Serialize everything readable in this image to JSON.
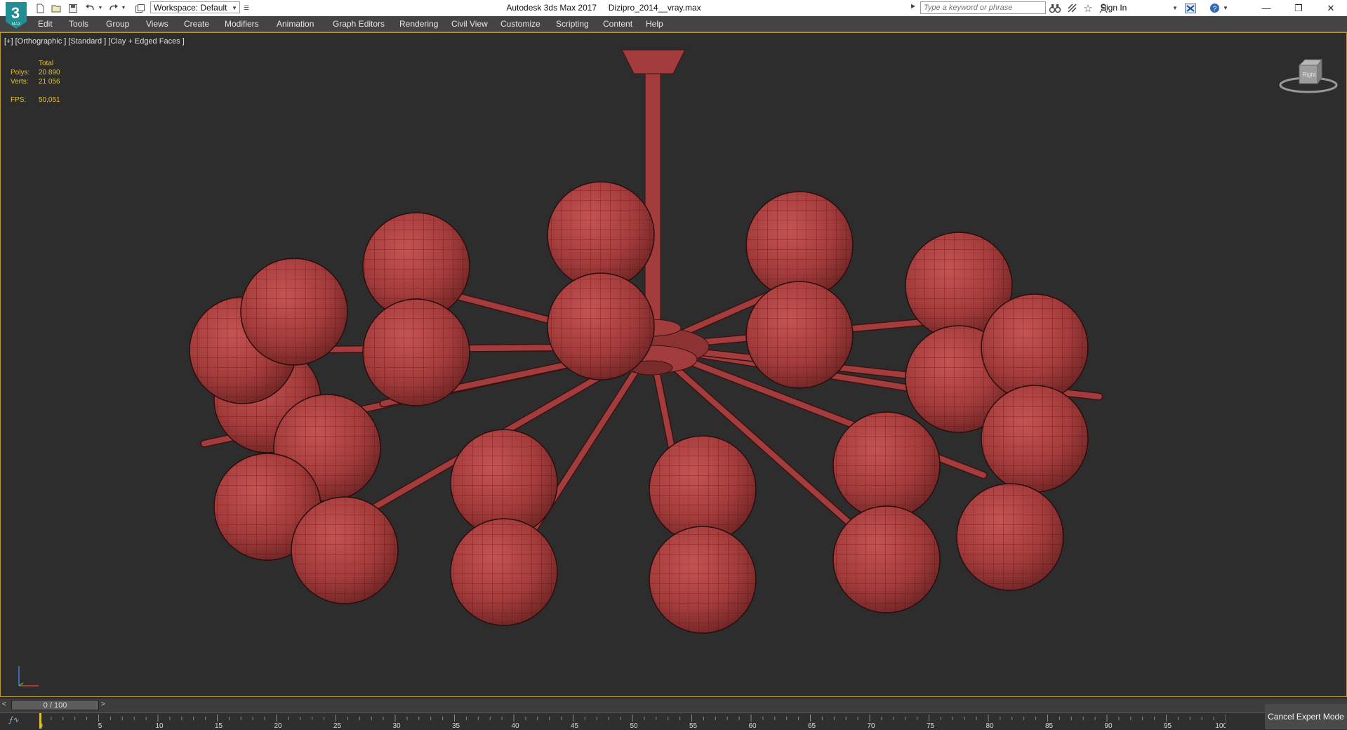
{
  "app": {
    "logo_text": "3",
    "logo_subtext": "MAX",
    "window_title": "Autodesk 3ds Max 2017     Dizipro_2014__vray.max"
  },
  "quick_access": {
    "workspace_value": "Workspace: Default",
    "icons": [
      "new-file-icon",
      "open-file-icon",
      "save-icon",
      "undo-icon",
      "redo-icon",
      "project-folder-icon"
    ]
  },
  "infocenter": {
    "search_placeholder": "Type a keyword or phrase",
    "sign_in": "Sign In",
    "icons": [
      "binoculars-icon",
      "subscription-icon",
      "favorites-star-icon",
      "user-icon",
      "exchange-icon",
      "help-icon"
    ]
  },
  "window_controls": [
    "minimize-icon",
    "restore-icon",
    "close-icon"
  ],
  "menu": [
    "Edit",
    "Tools",
    "Group",
    "Views",
    "Create",
    "Modifiers",
    "Animation",
    "Graph Editors",
    "Rendering",
    "Civil View",
    "Customize",
    "Scripting",
    "Content",
    "Help"
  ],
  "viewport": {
    "label": "[+] [Orthographic ] [Standard ] [Clay + Edged Faces ]",
    "stats": {
      "header": "Total",
      "polys_label": "Polys:",
      "polys_value": "20 890",
      "verts_label": "Verts:",
      "verts_value": "21 056",
      "fps_label": "FPS:",
      "fps_value": "50,051"
    },
    "viewcube_label": "Right",
    "model_color": "#a33c3c",
    "background_color": "#2d2d2d"
  },
  "timeline": {
    "slider_value": "0 / 100",
    "ticks": [
      "0",
      "5",
      "10",
      "15",
      "20",
      "25",
      "30",
      "35",
      "40",
      "45",
      "50",
      "55",
      "60",
      "65",
      "70",
      "75",
      "80",
      "85",
      "90",
      "95",
      "100"
    ]
  },
  "status": {
    "cancel_expert": "Cancel Expert Mode"
  }
}
